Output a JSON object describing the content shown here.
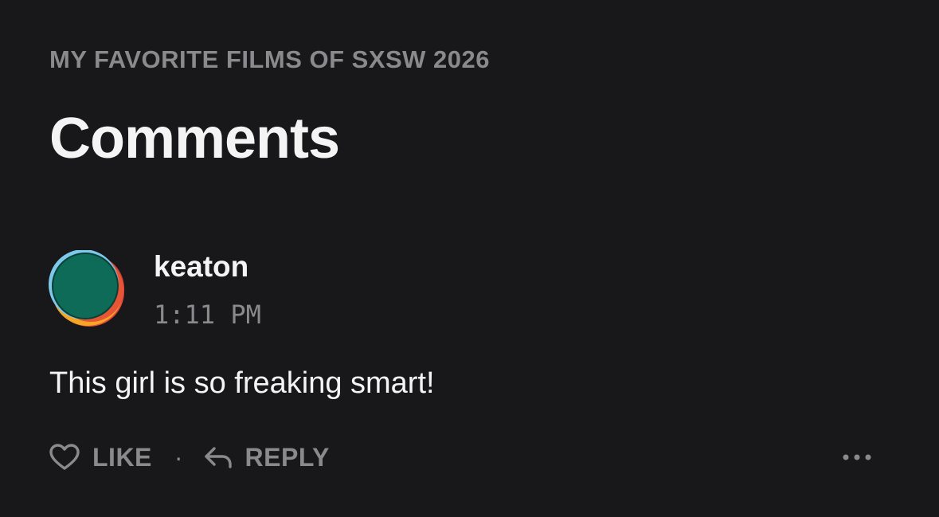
{
  "list": {
    "title": "MY FAVORITE FILMS OF SXSW 2026"
  },
  "page": {
    "title": "Comments"
  },
  "comment": {
    "username": "keaton",
    "time": "1:11 PM",
    "text": "This girl is so freaking smart!",
    "avatar": {
      "colors": [
        "#0d6b57",
        "#f6a623",
        "#e4463b",
        "#7ec8ec"
      ]
    }
  },
  "actions": {
    "like_label": "LIKE",
    "like_icon": "heart-outline-icon",
    "separator": "·",
    "reply_label": "REPLY",
    "reply_icon": "reply-arrow-icon",
    "more_icon": "more-horizontal-icon"
  },
  "theme": {
    "background": "#18181a",
    "text_primary": "#f4f4f4",
    "text_muted": "#8a8a8d"
  }
}
